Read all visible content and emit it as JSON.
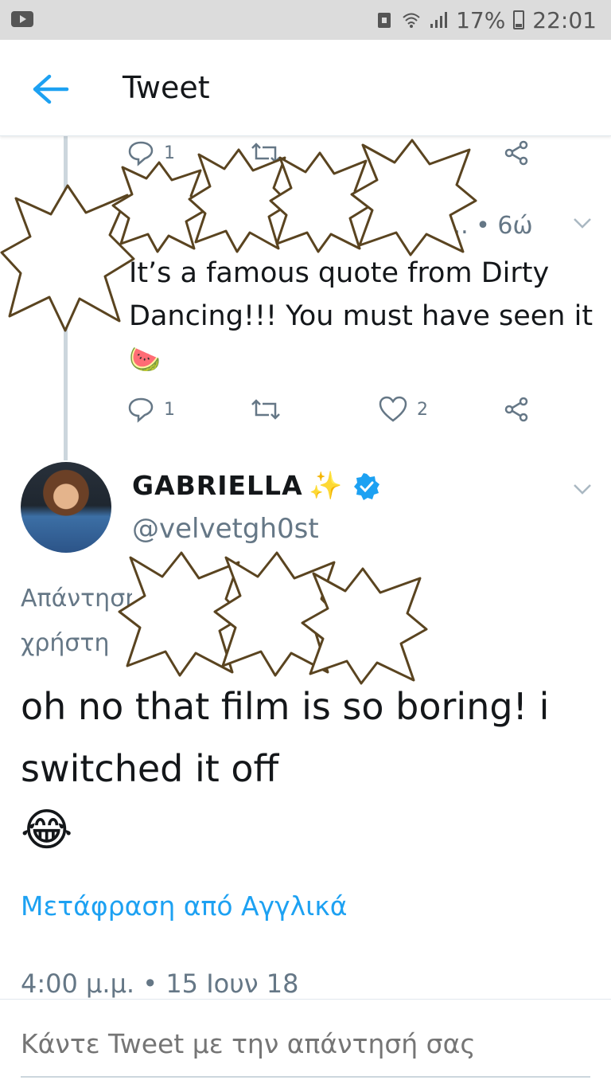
{
  "status_bar": {
    "battery": "17%",
    "time": "22:01"
  },
  "header": {
    "title": "Tweet",
    "back_icon": "arrow-left-icon"
  },
  "prev_tweet": {
    "top_actions": {
      "reply_count": "1"
    },
    "meta_time": "... • 6ώ",
    "text": "It’s a famous quote from Dirty Dancing!!! You must have seen it",
    "emoji": "🍉",
    "actions": {
      "reply_count": "1",
      "like_count": "2"
    }
  },
  "main_tweet": {
    "author_name": "GABRIELLA",
    "name_emoji": "✨",
    "handle": "@velvetgh0st",
    "reply_to_line1": "Απάντηση",
    "reply_to_line2": "χρήστη",
    "text": "oh no that film is so boring! i switched it off",
    "emoji": "😂",
    "translate_label": "Μετάφραση από Αγγλικά",
    "timestamp": "4:00 μ.μ. • 15 Ιουν 18"
  },
  "composer": {
    "placeholder": "Κάντε Tweet με την απάντησή σας"
  },
  "colors": {
    "accent": "#1da1f2",
    "secondary_text": "#657786",
    "status_bar_bg": "#dcdcdc"
  }
}
